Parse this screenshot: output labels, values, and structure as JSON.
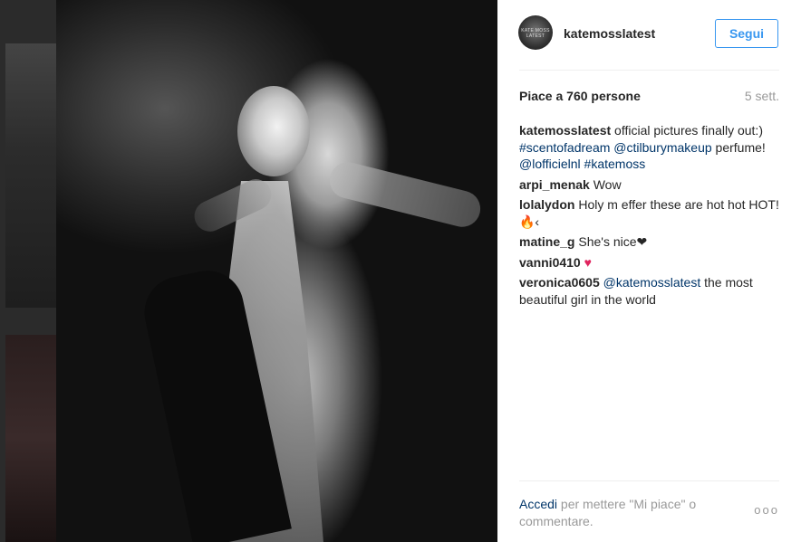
{
  "post": {
    "username": "katemosslatest",
    "avatar_text": "KATE MOSS LATEST",
    "follow_label": "Segui",
    "likes": "Piace a 760 persone",
    "age": "5 sett."
  },
  "caption": {
    "author": "katemosslatest",
    "text_1": " official pictures finally out:) ",
    "tag_1": "#scentofadream",
    "space_1": " ",
    "tag_2": "@ctilburymakeup",
    "text_2": " perfume! ",
    "tag_3": "@lofficielnl",
    "space_2": " ",
    "tag_4": "#katemoss"
  },
  "comments": [
    {
      "author": "arpi_menak",
      "text": " Wow"
    },
    {
      "author": "lolalydon",
      "text": " Holy m effer these are hot hot HOT! 🔥‹"
    },
    {
      "author": "matine_g",
      "text": " She's nice❤"
    },
    {
      "author": "vanni0410",
      "text": " ",
      "emoji": "♥"
    },
    {
      "author": "veronica0605",
      "mention": "@katemosslatest",
      "text": " the most beautiful girl in the world"
    }
  ],
  "footer": {
    "login_label": "Accedi",
    "rest": " per mettere \"Mi piace\" o commentare.",
    "more_icon": "ooo"
  },
  "colors": {
    "accent": "#3897f0",
    "link": "#003569",
    "heart": "#e0245e"
  }
}
